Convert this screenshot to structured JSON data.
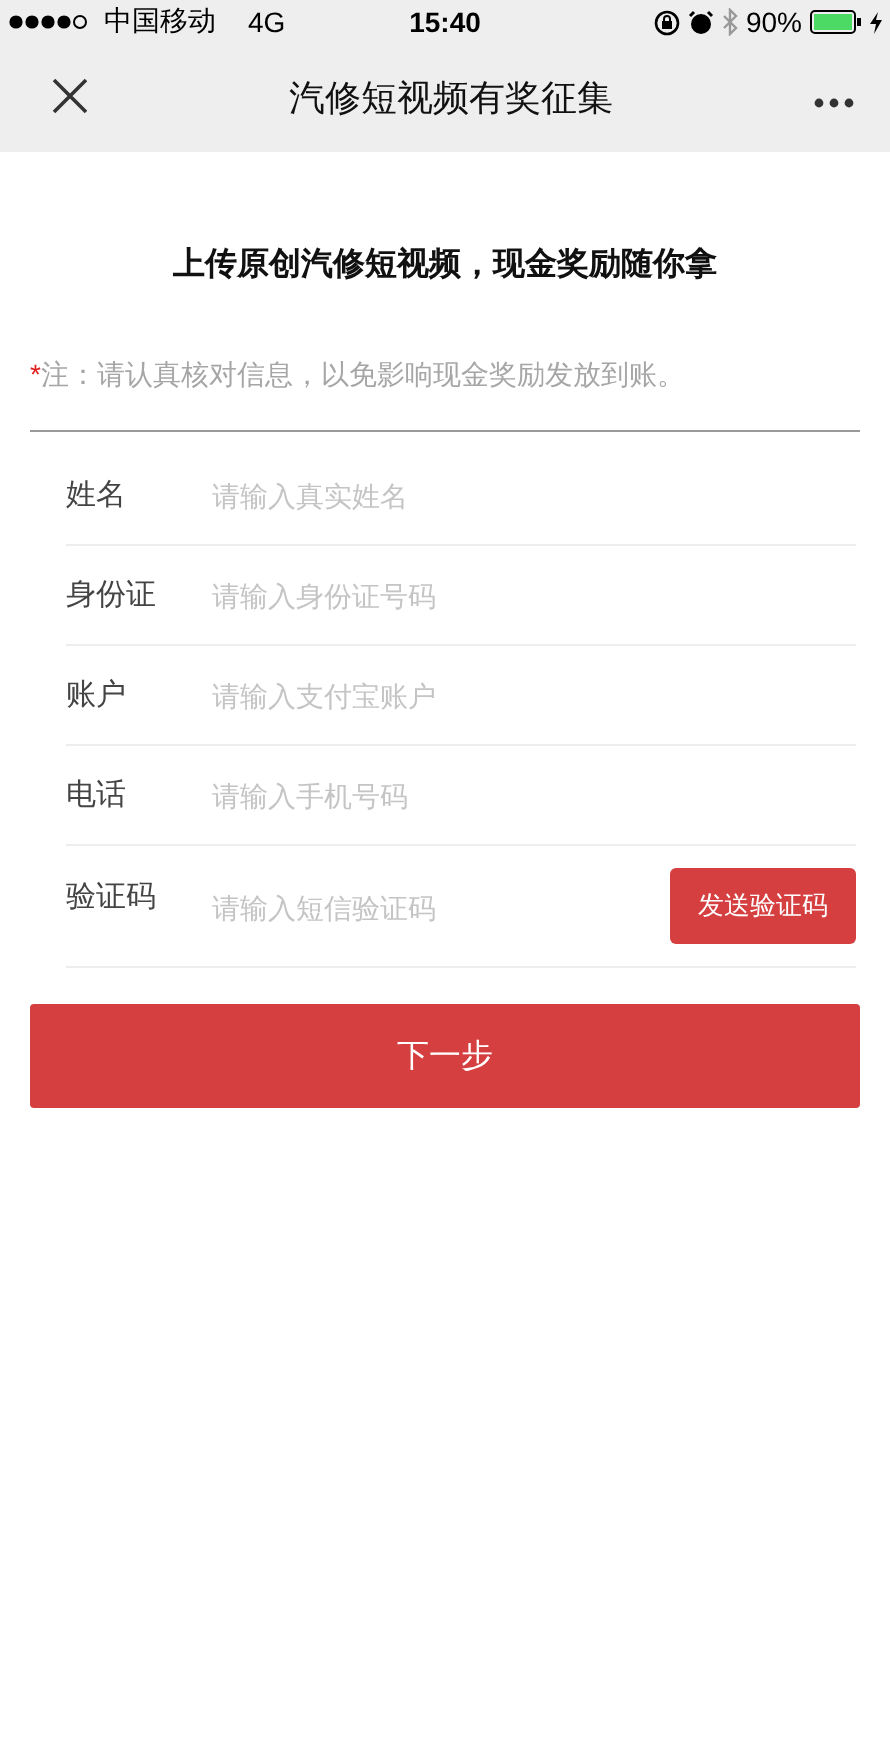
{
  "status_bar": {
    "carrier": "中国移动",
    "network": "4G",
    "time": "15:40",
    "battery": "90%"
  },
  "nav": {
    "title": "汽修短视频有奖征集"
  },
  "headline": "上传原创汽修短视频，现金奖励随你拿",
  "note": {
    "mark": "*",
    "text": "注：请认真核对信息，以免影响现金奖励发放到账。"
  },
  "fields": [
    {
      "kind": "input",
      "label": "姓名",
      "placeholder": "请输入真实姓名"
    },
    {
      "kind": "input",
      "label": "身份证",
      "placeholder": "请输入身份证号码"
    },
    {
      "kind": "input",
      "label": "账户",
      "placeholder": "请输入支付宝账户"
    },
    {
      "kind": "input",
      "label": "电话",
      "placeholder": "请输入手机号码"
    },
    {
      "kind": "code",
      "label": "验证码",
      "placeholder": "请输入短信验证码",
      "button": "发送验证码"
    }
  ],
  "next_button": "下一步"
}
